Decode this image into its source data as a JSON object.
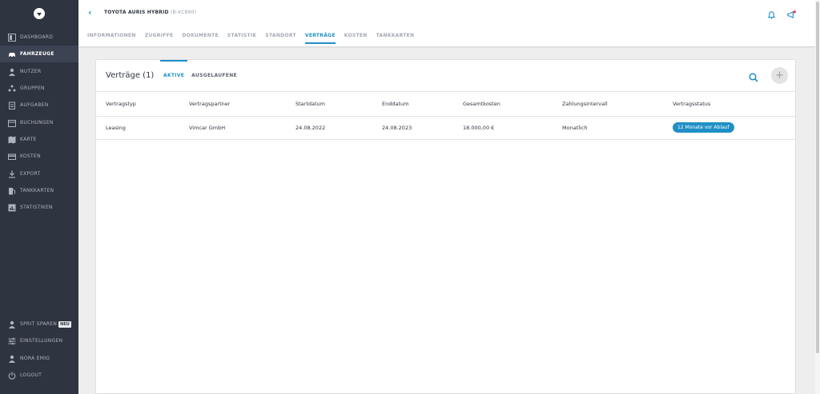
{
  "sidebar": {
    "items": [
      {
        "label": "DASHBOARD",
        "icon": "dashboard-icon"
      },
      {
        "label": "FAHRZEUGE",
        "icon": "car-icon",
        "active": true
      },
      {
        "label": "NUTZER",
        "icon": "user-icon"
      },
      {
        "label": "GRUPPEN",
        "icon": "groups-icon"
      },
      {
        "label": "AUFGABEN",
        "icon": "tasks-icon"
      },
      {
        "label": "BUCHUNGEN",
        "icon": "calendar-icon"
      },
      {
        "label": "KARTE",
        "icon": "map-icon"
      },
      {
        "label": "KOSTEN",
        "icon": "credit-card-icon"
      },
      {
        "label": "EXPORT",
        "icon": "download-icon"
      },
      {
        "label": "TANKKARTEN",
        "icon": "fuel-icon"
      },
      {
        "label": "STATISTIKEN",
        "icon": "chart-icon"
      }
    ],
    "bottom": [
      {
        "label": "SPRIT SPAREN",
        "icon": "user-icon",
        "badge": "NEU"
      },
      {
        "label": "EINSTELLUNGEN",
        "icon": "sliders-icon"
      },
      {
        "label": "NORA EMIG",
        "icon": "user-icon"
      },
      {
        "label": "LOGOUT",
        "icon": "power-icon"
      }
    ]
  },
  "header": {
    "title": "TOYOTA AURIS HYBRID",
    "plate": "(B-VC890)",
    "tabs": [
      "INFORMATIONEN",
      "ZUGRIFFE",
      "DOKUMENTE",
      "STATISTIK",
      "STANDORT",
      "VERTRÄGE",
      "KOSTEN",
      "TANKKARTEN"
    ],
    "active_tab": "VERTRÄGE"
  },
  "card": {
    "title": "Verträge (1)",
    "subtabs": [
      "AKTIVE",
      "AUSGELAUFENE"
    ],
    "columns": [
      "Vertragstyp",
      "Vertragspartner",
      "Startdatum",
      "Enddatum",
      "Gesamtkosten",
      "Zahlungsintervall",
      "Vertragsstatus"
    ],
    "rows": [
      [
        "Leasing",
        "Vimcar GmbH",
        "24.08.2022",
        "24.08.2023",
        "18.000,00 €",
        "Monatlich",
        "12 Monate vor Ablauf"
      ]
    ],
    "add_symbol": "+"
  },
  "colors": {
    "accent": "#1f8fc7",
    "sidebar_bg": "#2e3440",
    "notification_dot": "#e03a5c"
  }
}
